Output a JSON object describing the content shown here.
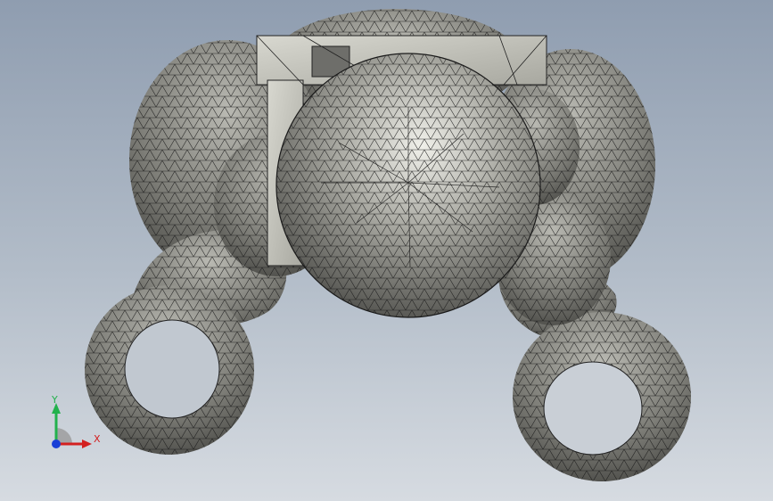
{
  "viewport": {
    "background_top": "#8f9db0",
    "background_bottom": "#d6dbe1"
  },
  "model": {
    "display_mode": "shaded-with-mesh-edges",
    "surface_color": "#8a8a84",
    "highlight_color": "#e8e8e0",
    "mesh_color": "#1a1a1a"
  },
  "triad": {
    "y_label": "Y",
    "x_label": "X",
    "y_color": "#22b14c",
    "x_color": "#d32020",
    "z_color": "#1a3fd6"
  }
}
